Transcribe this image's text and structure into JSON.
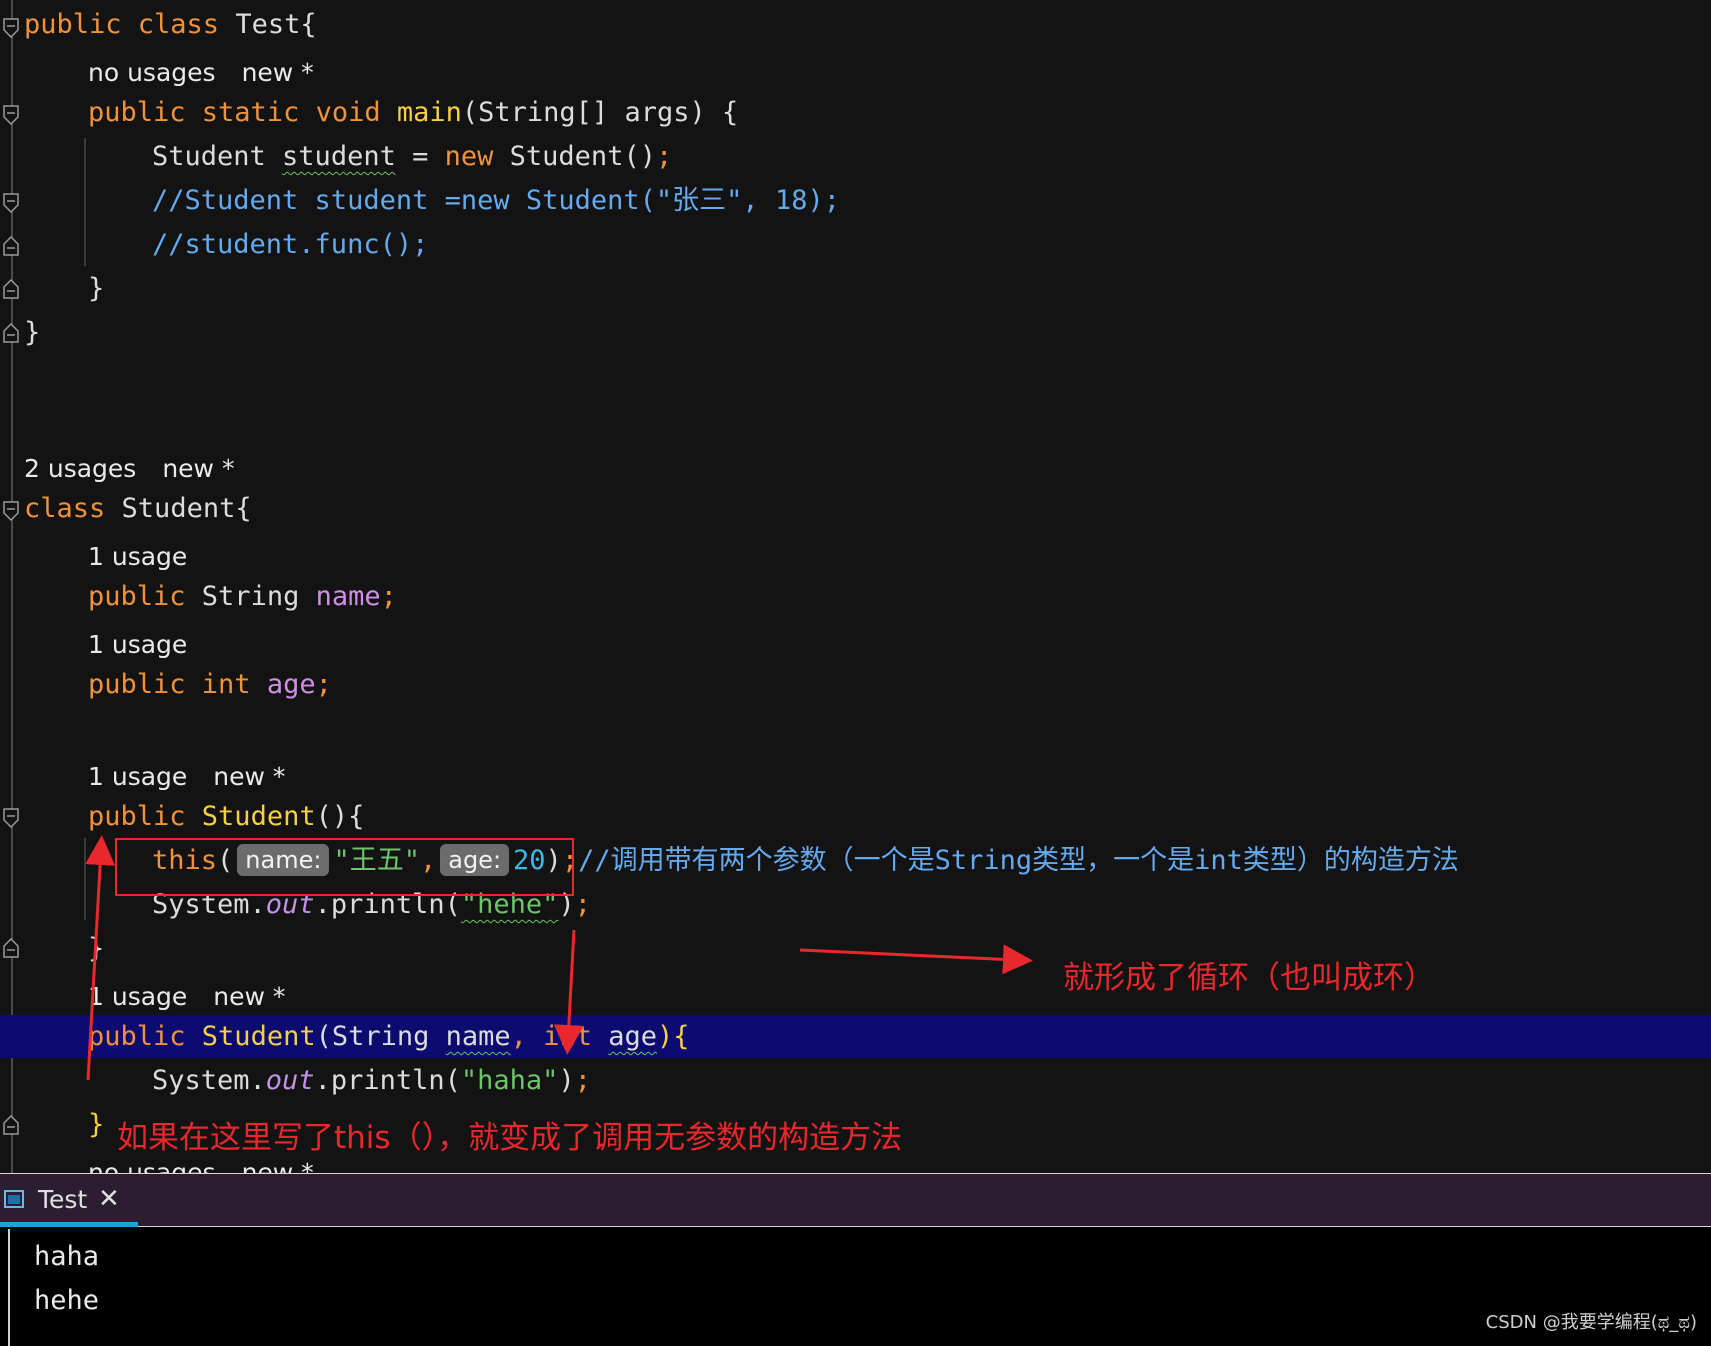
{
  "editor": {
    "hints": {
      "main": [
        "no usages",
        "new *"
      ],
      "student_class": [
        "2 usages",
        "new *"
      ],
      "name_field": [
        "1 usage"
      ],
      "age_field": [
        "1 usage"
      ],
      "ctor_noarg": [
        "1 usage",
        "new *"
      ],
      "ctor_args": [
        "1 usage",
        "new *"
      ],
      "bottom_cut": [
        "no usages",
        "new *"
      ]
    },
    "code": {
      "l1_kw": "public class ",
      "l1_name": "Test{",
      "l2_kw1": "public static void ",
      "l2_fn": "main",
      "l2_rest": "(String[] args) {",
      "l3_type": "Student ",
      "l3_var": "student",
      "l3_eq": " = ",
      "l3_new": "new ",
      "l3_call": "Student()",
      "l3_semi": ";",
      "l4_comment": "//Student student =new Student(\"张三\", 18);",
      "l5_comment": "//student.func();",
      "l6": "}",
      "l7": "}",
      "l8_kw": "class ",
      "l8_name": "Student{",
      "l9_kw": "public ",
      "l9_type": "String ",
      "l9_field": "name",
      "l9_semi": ";",
      "l10_kw": "public int ",
      "l10_field": "age",
      "l10_semi": ";",
      "l11_kw": "public ",
      "l11_fn": "Student",
      "l11_rest": "(){",
      "l12_this": "this",
      "l12_open": "(",
      "l12_hint_name": "name:",
      "l12_str": "\"王五\"",
      "l12_comma": ",",
      "l12_hint_age": "age:",
      "l12_num": "20",
      "l12_close": ")",
      "l12_semi": ";",
      "l12_comment": "//调用带有两个参数（一个是String类型，一个是int类型）的构造方法",
      "l13_sys": "System.",
      "l13_out": "out",
      "l13_call": ".println(",
      "l13_str": "\"hehe\"",
      "l13_close": ")",
      "l13_semi": ";",
      "l14": "}",
      "l15_kw": "public ",
      "l15_fn": "Student",
      "l15_open": "(String ",
      "l15_p1": "name",
      "l15_comma": ", ",
      "l15_kw2": "int ",
      "l15_p2": "age",
      "l15_rest": "){",
      "l16_sys": "System.",
      "l16_out": "out",
      "l16_call": ".println(",
      "l16_str": "\"haha\"",
      "l16_close": ")",
      "l16_semi": ";",
      "l17": "}"
    }
  },
  "annotations": {
    "loop_note": "就形成了循环（也叫成环）",
    "this_note": "如果在这里写了this（），就变成了调用无参数的构造方法"
  },
  "run_panel": {
    "tab_label": "Test",
    "tab_close": "✕",
    "output": [
      "haha",
      "hehe"
    ]
  },
  "watermark": "CSDN @我要学编程(ಥ_ಥ)",
  "icons": [
    "fold-icon",
    "console-icon",
    "close-icon"
  ],
  "colors": {
    "keyword": "#f0923a",
    "function": "#f6cf42",
    "field": "#d08ee6",
    "comment": "#63aaf0",
    "string": "#6dc46a",
    "number": "#3cb8e6",
    "annotation_red": "#e8282c",
    "selection": "#0c0c70"
  }
}
